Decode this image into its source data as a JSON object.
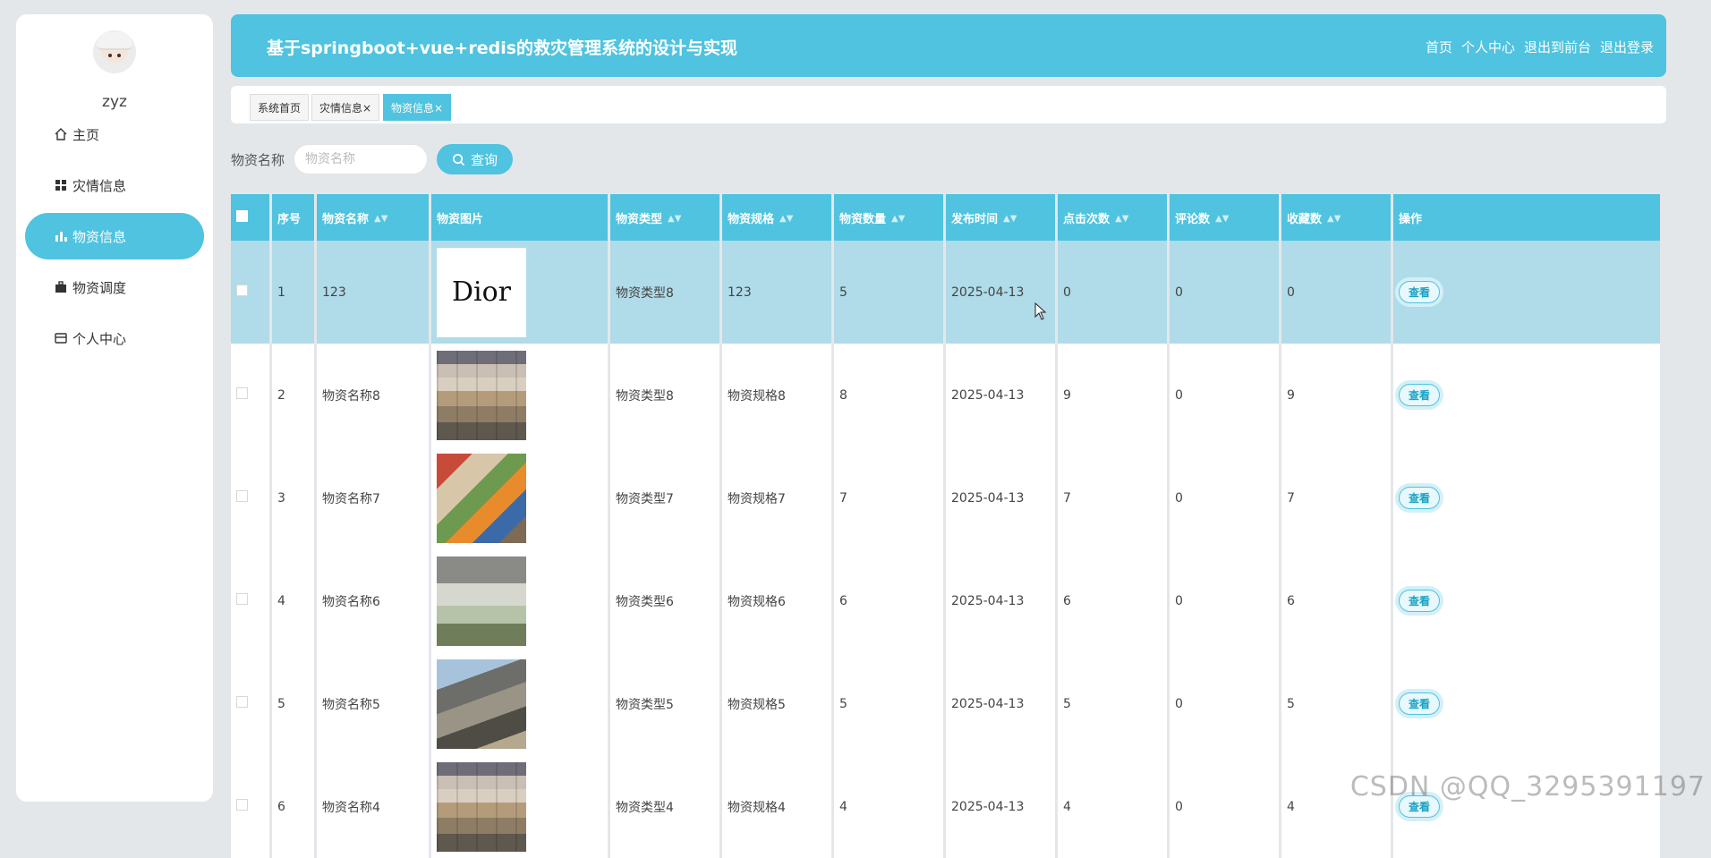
{
  "user": {
    "name": "zyz"
  },
  "sidebar": {
    "items": [
      {
        "label": "主页",
        "icon": "home-icon"
      },
      {
        "label": "灾情信息",
        "icon": "grid-icon"
      },
      {
        "label": "物资信息",
        "icon": "bar-chart-icon",
        "active": true
      },
      {
        "label": "物资调度",
        "icon": "briefcase-icon"
      },
      {
        "label": "个人中心",
        "icon": "card-icon"
      }
    ]
  },
  "header": {
    "title": "基于springboot+vue+redis的救灾管理系统的设计与实现",
    "links": [
      "首页",
      "个人中心",
      "退出到前台",
      "退出登录"
    ]
  },
  "tabs": [
    {
      "label": "系统首页"
    },
    {
      "label": "灾情信息×"
    },
    {
      "label": "物资信息×",
      "active": true
    }
  ],
  "search": {
    "label": "物资名称",
    "placeholder": "物资名称",
    "button": "查询"
  },
  "table": {
    "headers": [
      "序号",
      "物资名称",
      "物资图片",
      "物资类型",
      "物资规格",
      "物资数量",
      "发布时间",
      "点击次数",
      "评论数",
      "收藏数",
      "操作"
    ],
    "view_label": "查看",
    "rows": [
      {
        "no": "1",
        "name": "123",
        "image": "dior",
        "image_text": "Dior",
        "type": "物资类型8",
        "spec": "123",
        "qty": "5",
        "time": "2025-04-13",
        "clicks": "0",
        "comments": "0",
        "favs": "0"
      },
      {
        "no": "2",
        "name": "物资名称8",
        "image": "boxes",
        "type": "物资类型8",
        "spec": "物资规格8",
        "qty": "8",
        "time": "2025-04-13",
        "clicks": "9",
        "comments": "0",
        "favs": "9"
      },
      {
        "no": "3",
        "name": "物资名称7",
        "image": "food",
        "type": "物资类型7",
        "spec": "物资规格7",
        "qty": "7",
        "time": "2025-04-13",
        "clicks": "7",
        "comments": "0",
        "favs": "7"
      },
      {
        "no": "4",
        "name": "物资名称6",
        "image": "sacks",
        "type": "物资类型6",
        "spec": "物资规格6",
        "qty": "6",
        "time": "2025-04-13",
        "clicks": "6",
        "comments": "0",
        "favs": "6"
      },
      {
        "no": "5",
        "name": "物资名称5",
        "image": "rubble",
        "type": "物资类型5",
        "spec": "物资规格5",
        "qty": "5",
        "time": "2025-04-13",
        "clicks": "5",
        "comments": "0",
        "favs": "5"
      },
      {
        "no": "6",
        "name": "物资名称4",
        "image": "boxes",
        "type": "物资类型4",
        "spec": "物资规格4",
        "qty": "4",
        "time": "2025-04-13",
        "clicks": "4",
        "comments": "0",
        "favs": "4"
      }
    ]
  },
  "watermark": "CSDN @QQ_3295391197",
  "colors": {
    "accent": "#4fc3df",
    "selected_row": "#b0dbe8",
    "background": "#e4e7ea"
  }
}
